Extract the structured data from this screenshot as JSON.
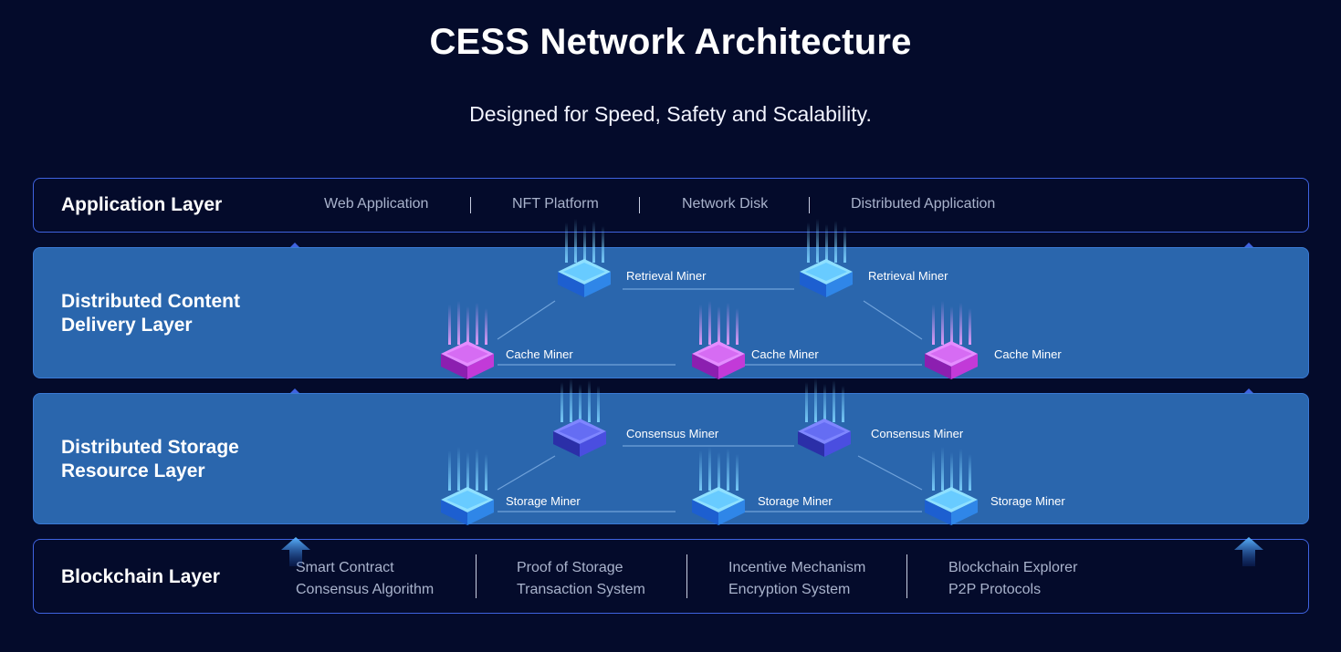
{
  "header": {
    "title": "CESS Network Architecture",
    "subtitle": "Designed for Speed, Safety and Scalability."
  },
  "application_layer": {
    "title": "Application Layer",
    "items": [
      "Web Application",
      "NFT Platform",
      "Network Disk",
      "Distributed Application"
    ]
  },
  "content_delivery_layer": {
    "title_line1": "Distributed Content",
    "title_line2": "Delivery Layer",
    "nodes": {
      "retrieval_1": "Retrieval Miner",
      "retrieval_2": "Retrieval Miner",
      "cache_1": "Cache Miner",
      "cache_2": "Cache Miner",
      "cache_3": "Cache Miner"
    }
  },
  "storage_layer": {
    "title_line1": "Distributed Storage",
    "title_line2": "Resource Layer",
    "nodes": {
      "consensus_1": "Consensus Miner",
      "consensus_2": "Consensus Miner",
      "storage_1": "Storage Miner",
      "storage_2": "Storage Miner",
      "storage_3": "Storage Miner"
    }
  },
  "blockchain_layer": {
    "title": "Blockchain Layer",
    "columns": [
      {
        "line1": "Smart Contract",
        "line2": "Consensus Algorithm"
      },
      {
        "line1": "Proof of Storage",
        "line2": "Transaction System"
      },
      {
        "line1": "Incentive Mechanism",
        "line2": "Encryption System"
      },
      {
        "line1": "Blockchain Explorer",
        "line2": "P2P Protocols"
      }
    ]
  },
  "colors": {
    "background": "#040b2b",
    "layer_blue": "#2a66ad",
    "border": "#3f63e0",
    "server_blue": "#2ea8f0",
    "server_magenta": "#c23ad8",
    "server_indigo": "#4a4ee0"
  },
  "icons": [
    "server-blue-icon",
    "server-magenta-icon",
    "server-indigo-icon",
    "up-arrow-icon"
  ]
}
